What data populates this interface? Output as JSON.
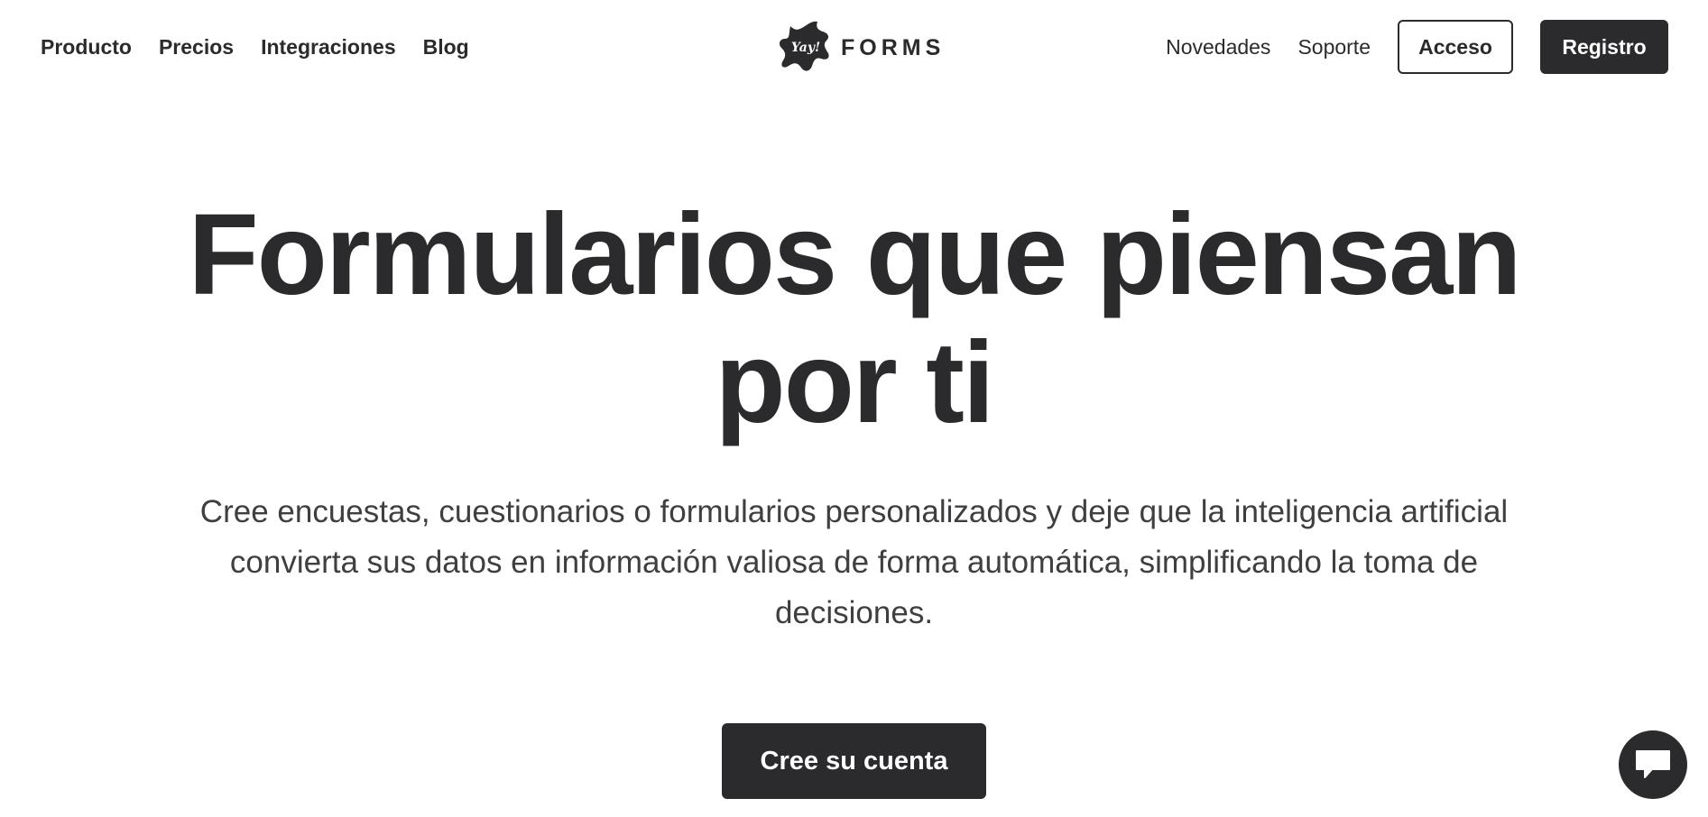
{
  "nav": {
    "left": [
      "Producto",
      "Precios",
      "Integraciones",
      "Blog"
    ],
    "logo": {
      "mark_text": "Yay!",
      "wordmark": "FORMS"
    },
    "right": {
      "novedades": "Novedades",
      "soporte": "Soporte",
      "acceso": "Acceso",
      "registro": "Registro"
    }
  },
  "hero": {
    "title_line1": "Formularios que piensan",
    "title_line2": "por ti",
    "subtitle": "Cree encuestas, cuestionarios o formularios personalizados y deje que la inteligencia artificial convierta sus datos en información valiosa de forma automática, simplificando la toma de decisiones.",
    "cta": "Cree su cuenta"
  },
  "chat": {
    "icon": "chat-icon"
  },
  "colors": {
    "text": "#2b2b2d",
    "background": "#ffffff",
    "button": "#2b2b2d"
  }
}
